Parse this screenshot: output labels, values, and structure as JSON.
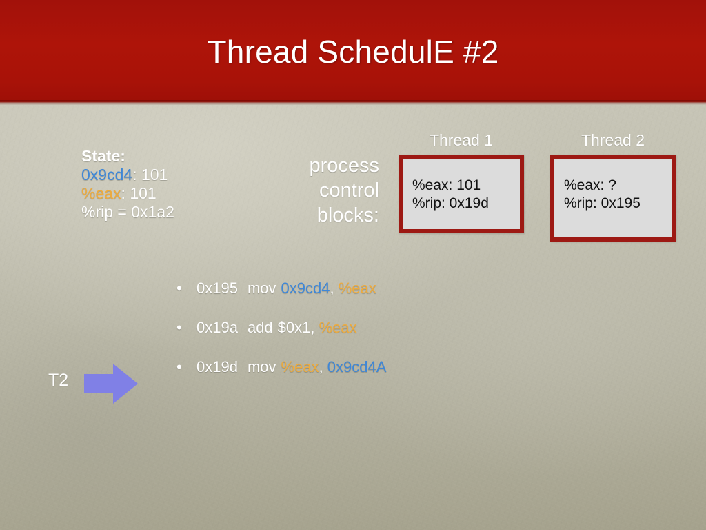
{
  "slide": {
    "title": "Thread SchedulE #2",
    "banner_color": "#a81208",
    "body_color": "#b6b4a3"
  },
  "state": {
    "heading": "State:",
    "lines": [
      {
        "key": "0x9cd4",
        "key_color": "blue",
        "value": ": 101"
      },
      {
        "key": "%eax",
        "key_color": "orange",
        "value": ": 101"
      },
      {
        "key": "%rip = 0x1a2",
        "key_color": "white",
        "value": ""
      }
    ]
  },
  "pcb": {
    "label_lines": [
      "process",
      "control",
      "blocks:"
    ]
  },
  "threads": [
    {
      "caption": "Thread 1",
      "registers": [
        "%eax: 101",
        "%rip: 0x19d"
      ],
      "border_color": "#9d1913",
      "fill_color": "#dcdcdc"
    },
    {
      "caption": "Thread 2",
      "registers": [
        "%eax: ?",
        "%rip: 0x195"
      ],
      "border_color": "#9d1913",
      "fill_color": "#dcdcdc"
    }
  ],
  "instructions": {
    "bullet_glyph": "•",
    "rows": [
      {
        "address": "0x195",
        "opcode": "mov",
        "operands": [
          {
            "text": "0x9cd4",
            "color": "blue"
          },
          {
            "text": ", ",
            "color": "white"
          },
          {
            "text": "%eax",
            "color": "orange"
          }
        ]
      },
      {
        "address": "0x19a",
        "opcode": "add",
        "operands": [
          {
            "text": "$0x1",
            "color": "white"
          },
          {
            "text": ", ",
            "color": "white"
          },
          {
            "text": "%eax",
            "color": "orange"
          }
        ]
      },
      {
        "address": "0x19d",
        "opcode": "mov",
        "operands": [
          {
            "text": "%eax",
            "color": "orange"
          },
          {
            "text": ", ",
            "color": "white"
          },
          {
            "text": "0x9cd4A",
            "color": "blue"
          }
        ]
      }
    ]
  },
  "marker": {
    "label": "T2",
    "arrow_color": "#8080e6",
    "arrow_direction": "right"
  },
  "colors": {
    "blue": "#3e87d8",
    "orange": "#edab3e",
    "white": "#ffffff",
    "banner_red": "#a81208",
    "box_border_red": "#9d1913"
  }
}
